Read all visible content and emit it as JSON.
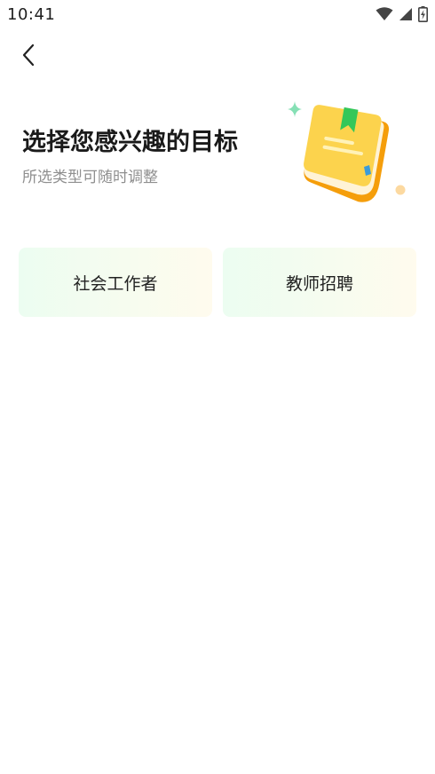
{
  "status_bar": {
    "time": "10:41",
    "icons": [
      "wifi-icon",
      "cellular-signal-icon",
      "battery-icon"
    ]
  },
  "nav": {
    "back_icon": "chevron-left-icon"
  },
  "header": {
    "title": "选择您感兴趣的目标",
    "subtitle": "所选类型可随时调整",
    "illustration": "book-icon"
  },
  "options": [
    {
      "label": "社会工作者"
    },
    {
      "label": "教师招聘"
    }
  ],
  "colors": {
    "card_gradient_start": "#ecfdf1",
    "card_gradient_end": "#fffbee",
    "book_yellow": "#fcd34d",
    "book_orange": "#f59e0b",
    "bookmark_green": "#34c759",
    "sparkle_green": "#86e0b5"
  }
}
